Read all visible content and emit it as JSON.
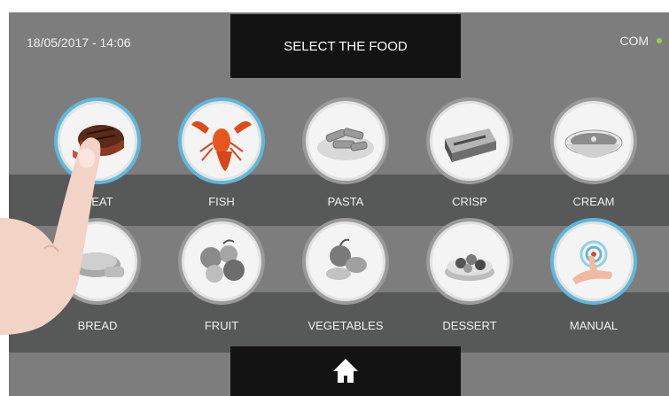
{
  "header": {
    "datetime": "18/05/2017 - 14:06",
    "title": "SELECT THE FOOD",
    "status": "COM",
    "status_color": "#8fd14a"
  },
  "accent_color": "#5fb7dc",
  "foods": [
    {
      "label": "MEAT",
      "icon": "meat-icon",
      "selected": true
    },
    {
      "label": "FISH",
      "icon": "lobster-icon",
      "selected": true
    },
    {
      "label": "PASTA",
      "icon": "pasta-icon",
      "selected": false
    },
    {
      "label": "CRISP",
      "icon": "lasagna-icon",
      "selected": false
    },
    {
      "label": "CREAM",
      "icon": "soup-bowl-icon",
      "selected": false
    },
    {
      "label": "BREAD",
      "icon": "bread-icon",
      "selected": false
    },
    {
      "label": "FRUIT",
      "icon": "fruit-icon",
      "selected": false
    },
    {
      "label": "VEGETABLES",
      "icon": "vegetables-icon",
      "selected": false
    },
    {
      "label": "DESSERT",
      "icon": "tart-icon",
      "selected": false
    },
    {
      "label": "MANUAL",
      "icon": "touch-hand-icon",
      "selected": true
    }
  ],
  "footer": {
    "home_icon": "home-icon"
  }
}
